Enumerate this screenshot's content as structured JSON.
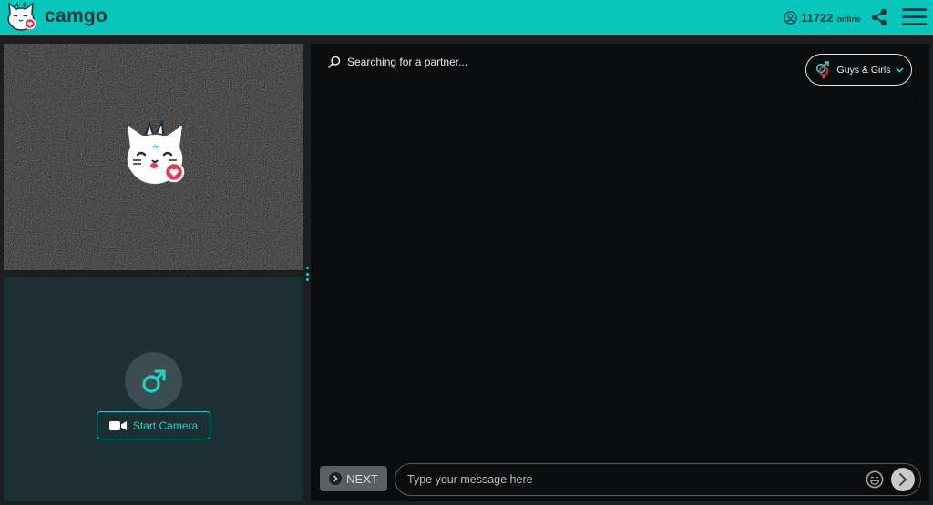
{
  "header": {
    "brand": "camgo",
    "online_count": "11722",
    "online_label": "online"
  },
  "icons": {
    "logo": "cat-logo-icon",
    "users": "user-circle-icon",
    "share": "share-icon",
    "menu": "hamburger-menu-icon",
    "gender": "male-symbol-icon",
    "camera": "video-camera-icon",
    "search": "search-icon",
    "filter": "gender-filter-icon",
    "chevron": "chevron-down-icon",
    "next": "chevron-right-icon",
    "emoji": "emoji-icon",
    "send": "send-arrow-icon"
  },
  "self_video": {
    "start_camera_label": "Start Camera"
  },
  "chat": {
    "status_text": "Searching for a partner...",
    "gender_filter_label": "Guys & Girls",
    "next_label": "NEXT",
    "message_placeholder": "Type your message here"
  },
  "colors": {
    "accent": "#08c6bb",
    "accent_text": "#25cfc3",
    "header_text": "#103b3d",
    "chat_bg": "#0c0d0f",
    "self_video_bg": "#1c3033",
    "heart": "#e53b4a"
  }
}
